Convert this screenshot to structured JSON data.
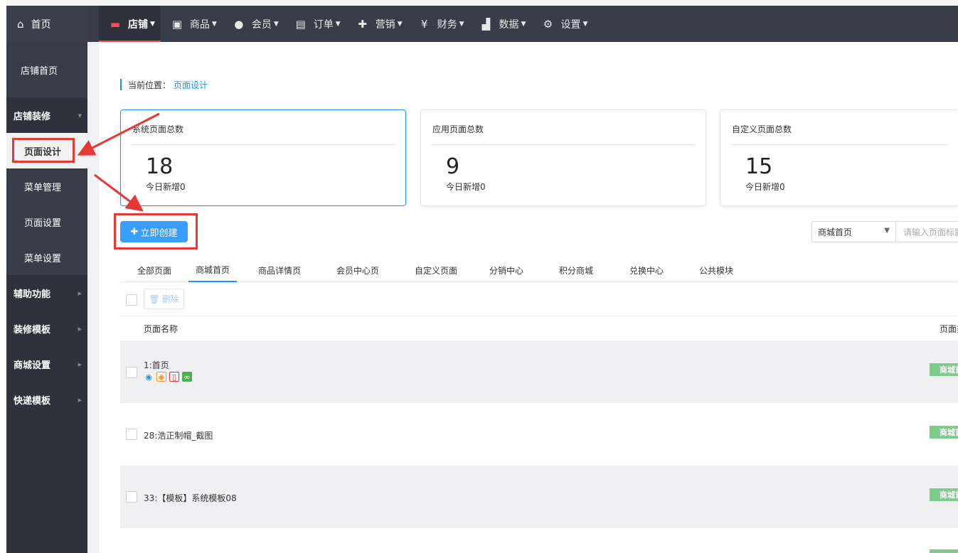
{
  "nav": {
    "home": "首页",
    "items": [
      {
        "label": "店铺",
        "icon": "store-icon",
        "glyph": "▬",
        "active": true
      },
      {
        "label": "商品",
        "icon": "goods-icon",
        "glyph": "▣",
        "active": false
      },
      {
        "label": "会员",
        "icon": "user-icon",
        "glyph": "●",
        "active": false
      },
      {
        "label": "订单",
        "icon": "order-icon",
        "glyph": "▤",
        "active": false
      },
      {
        "label": "营销",
        "icon": "gift-icon",
        "glyph": "✚",
        "active": false
      },
      {
        "label": "财务",
        "icon": "money-bag-icon",
        "glyph": "¥",
        "active": false
      },
      {
        "label": "数据",
        "icon": "chart-icon",
        "glyph": "▟",
        "active": false
      },
      {
        "label": "设置",
        "icon": "gear-icon",
        "glyph": "⚙",
        "active": false
      }
    ]
  },
  "sidebar": {
    "store_home": "店铺首页",
    "groups": {
      "decoration": "店铺装修",
      "page_design": "页面设计",
      "menu_manage": "菜单管理",
      "page_settings": "页面设置",
      "menu_settings": "菜单设置",
      "aux": "辅助功能",
      "templates": "装修模板",
      "mall_settings": "商城设置",
      "express": "快递模板"
    }
  },
  "breadcrumb": {
    "label": "当前位置：",
    "current": "页面设计"
  },
  "stats": [
    {
      "title": "系统页面总数",
      "value": "18",
      "sub": "今日新增0"
    },
    {
      "title": "应用页面总数",
      "value": "9",
      "sub": "今日新增0"
    },
    {
      "title": "自定义页面总数",
      "value": "15",
      "sub": "今日新增0"
    }
  ],
  "create_button": "立即创建",
  "filter": {
    "selected": "商城首页",
    "search_placeholder": "请输入页面标题"
  },
  "tabs": [
    "全部页面",
    "商城首页",
    "商品详情页",
    "会员中心页",
    "自定义页面",
    "分销中心",
    "积分商城",
    "兑换中心",
    "公共模块"
  ],
  "active_tab": 1,
  "delete_button": "删除",
  "table": {
    "col_name": "页面名称",
    "col_type": "页面类型",
    "rows": [
      {
        "name": "1:首页",
        "badge": "商城首页"
      },
      {
        "name": "28:浩正制帽_截图",
        "badge": "商城首页"
      },
      {
        "name": "33:【模板】系统模板08",
        "badge": "商城首页"
      }
    ]
  },
  "colors": {
    "accent": "#1890ff",
    "annotation": "#e53935",
    "badge": "#7ccb89"
  }
}
